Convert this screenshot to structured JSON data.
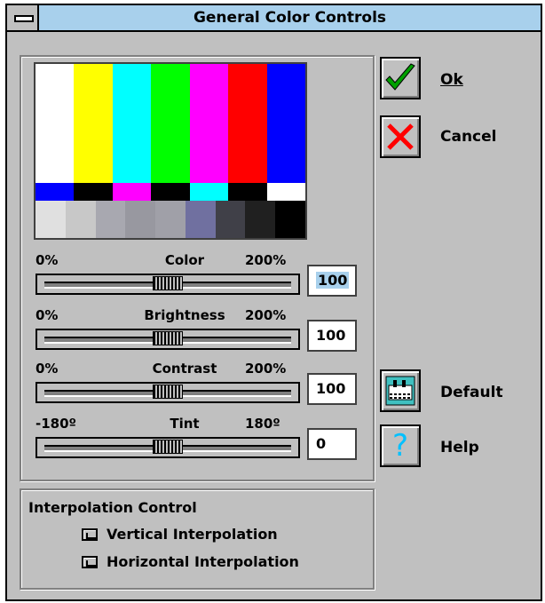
{
  "window": {
    "title": "General Color Controls"
  },
  "test_pattern": {
    "bars": [
      "#ffffff",
      "#ffff00",
      "#00ffff",
      "#00ff00",
      "#ff00ff",
      "#ff0000",
      "#0000ff"
    ],
    "castellations": [
      "#0000ff",
      "#000000",
      "#ff00ff",
      "#000000",
      "#00ffff",
      "#000000",
      "#ffffff"
    ],
    "pluge": [
      "#e0e0e0",
      "#c8c8c8",
      "#a8a8b0",
      "#9898a0",
      "#a0a0a8",
      "#7070a0",
      "#404048",
      "#202020",
      "#000000"
    ]
  },
  "sliders": [
    {
      "label": "Color",
      "min_label": "0%",
      "max_label": "200%",
      "value": "100",
      "level": 0.5
    },
    {
      "label": "Brightness",
      "min_label": "0%",
      "max_label": "200%",
      "value": "100",
      "level": 0.5
    },
    {
      "label": "Contrast",
      "min_label": "0%",
      "max_label": "200%",
      "value": "100",
      "level": 0.5
    },
    {
      "label": "Tint",
      "min_label": "-180º",
      "max_label": "180º",
      "value": "0",
      "level": 0.5
    }
  ],
  "buttons": {
    "ok": "Ok",
    "cancel": "Cancel",
    "default": "Default",
    "help": "Help"
  },
  "interpolation": {
    "title": "Interpolation Control",
    "vertical": "Vertical Interpolation",
    "horizontal": "Horizontal Interpolation"
  },
  "colors": {
    "title_bar": "#a8d0ec",
    "face": "#c0c0c0",
    "ok_check": "#00a000",
    "cancel_x": "#ff0000",
    "help_q": "#00c0ff"
  }
}
